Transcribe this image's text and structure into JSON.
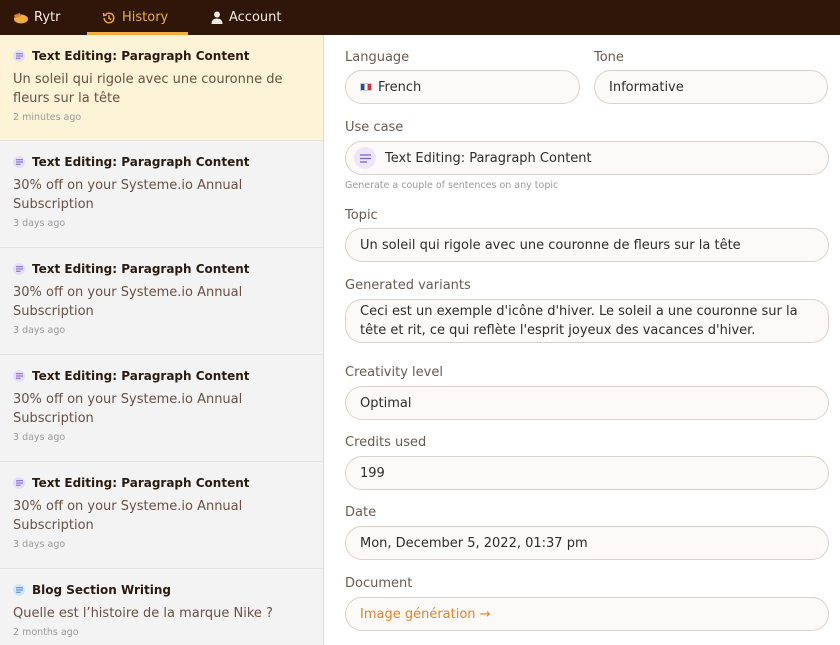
{
  "nav": {
    "brand": "Rytr",
    "history": "History",
    "account": "Account"
  },
  "history": [
    {
      "type": "Text Editing: Paragraph Content",
      "text": "Un soleil qui rigole avec une couronne de fleurs sur la tête",
      "time": "2 minutes ago",
      "icon": "paragraph-icon"
    },
    {
      "type": "Text Editing: Paragraph Content",
      "text": "30% off on your Systeme.io Annual Subscription",
      "time": "3 days ago",
      "icon": "paragraph-icon"
    },
    {
      "type": "Text Editing: Paragraph Content",
      "text": "30% off on your Systeme.io Annual Subscription",
      "time": "3 days ago",
      "icon": "paragraph-icon"
    },
    {
      "type": "Text Editing: Paragraph Content",
      "text": "30% off on your Systeme.io Annual Subscription",
      "time": "3 days ago",
      "icon": "paragraph-icon"
    },
    {
      "type": "Text Editing: Paragraph Content",
      "text": "30% off on your Systeme.io Annual Subscription",
      "time": "3 days ago",
      "icon": "paragraph-icon"
    },
    {
      "type": "Blog Section Writing",
      "text": "Quelle est l’histoire de la marque Nike ?",
      "time": "2 months ago",
      "icon": "blog-icon"
    }
  ],
  "form": {
    "language_label": "Language",
    "language_value": "French",
    "tone_label": "Tone",
    "tone_value": "Informative",
    "usecase_label": "Use case",
    "usecase_value": "Text Editing: Paragraph Content",
    "usecase_hint": "Generate a couple of sentences on any topic",
    "topic_label": "Topic",
    "topic_value": "Un soleil qui rigole avec une couronne de fleurs sur la tête",
    "variants_label": "Generated variants",
    "variants_value": "Ceci est un exemple d'icône d'hiver. Le soleil a une couronne sur la tête et rit, ce qui reflète l'esprit joyeux des vacances d'hiver.",
    "creativity_label": "Creativity level",
    "creativity_value": "Optimal",
    "credits_label": "Credits used",
    "credits_value": "199",
    "date_label": "Date",
    "date_value": "Mon, December 5, 2022, 01:37 pm",
    "document_label": "Document",
    "document_value": "Image génération →"
  },
  "colors": {
    "topbar": "#2f1608",
    "accent": "#f2ad3b",
    "link": "#e7822c",
    "active_item": "#fdf3d6"
  }
}
